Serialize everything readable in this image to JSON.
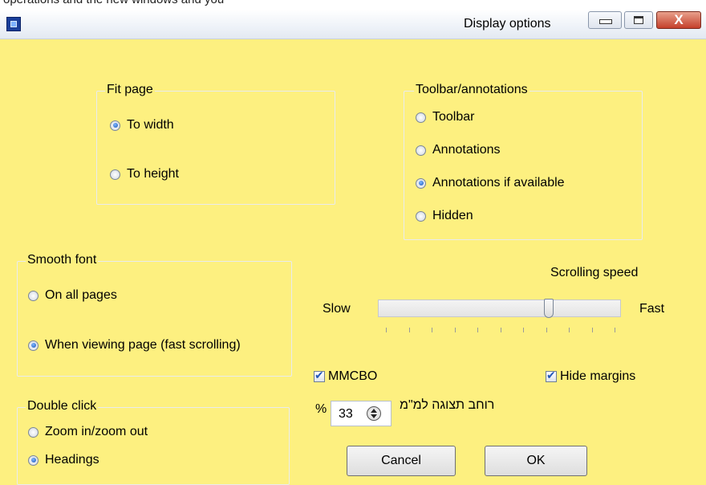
{
  "window": {
    "title": "Display options",
    "top_text": "operations and the new windows and you"
  },
  "fit_page": {
    "legend": "Fit page",
    "options": [
      {
        "label": "To  width",
        "checked": true
      },
      {
        "label": "To  height",
        "checked": false
      }
    ]
  },
  "toolbar_annotations": {
    "legend": "Toolbar/annotations",
    "options": [
      {
        "label": "Toolbar",
        "checked": false
      },
      {
        "label": "Annotations",
        "checked": false
      },
      {
        "label": "Annotations if available",
        "checked": true
      },
      {
        "label": "Hidden",
        "checked": false
      }
    ]
  },
  "smooth_font": {
    "legend": "Smooth font",
    "options": [
      {
        "label": "On all pages",
        "checked": false
      },
      {
        "label": "When viewing page (fast scrolling)",
        "checked": true
      }
    ]
  },
  "double_click": {
    "legend": "Double click",
    "options": [
      {
        "label": "Zoom in/zoom out",
        "checked": false
      },
      {
        "label": "Headings",
        "checked": true
      }
    ]
  },
  "scrolling": {
    "label": "Scrolling speed",
    "slow": "Slow",
    "fast": "Fast",
    "value_fraction": 0.72
  },
  "checkboxes": {
    "mmcbo": "MMCBO",
    "hide_margins": "Hide margins",
    "mmcbo_checked": true,
    "hide_margins_checked": true
  },
  "zoom": {
    "percent_sign": "%",
    "value": "33",
    "hebrew_label": "רוחב תצוגה למ\"מ"
  },
  "buttons": {
    "cancel": "Cancel",
    "ok": "OK"
  }
}
